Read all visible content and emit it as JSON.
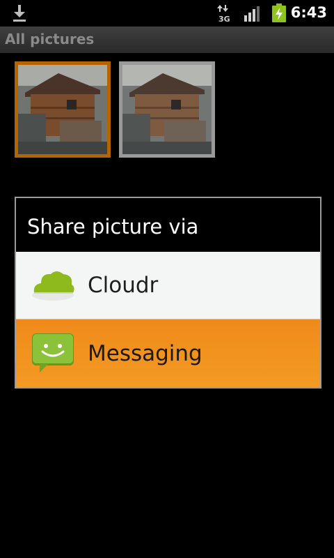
{
  "status_bar": {
    "time": "6:43",
    "network": "3G",
    "icons": [
      "download-icon",
      "network-3g-icon",
      "signal-icon",
      "battery-charging-icon"
    ]
  },
  "titlebar": {
    "title": "All pictures"
  },
  "gallery": {
    "thumbnails": [
      {
        "state": "selected"
      },
      {
        "state": "normal"
      }
    ]
  },
  "dialog": {
    "title": "Share picture via",
    "options": [
      {
        "label": "Cloudr",
        "icon": "cloud-icon"
      },
      {
        "label": "Messaging",
        "icon": "messaging-icon",
        "highlighted": true
      }
    ]
  },
  "colors": {
    "highlight": "#F39A24",
    "cloud_green": "#8FBA1E",
    "message_green": "#7FB22A"
  }
}
